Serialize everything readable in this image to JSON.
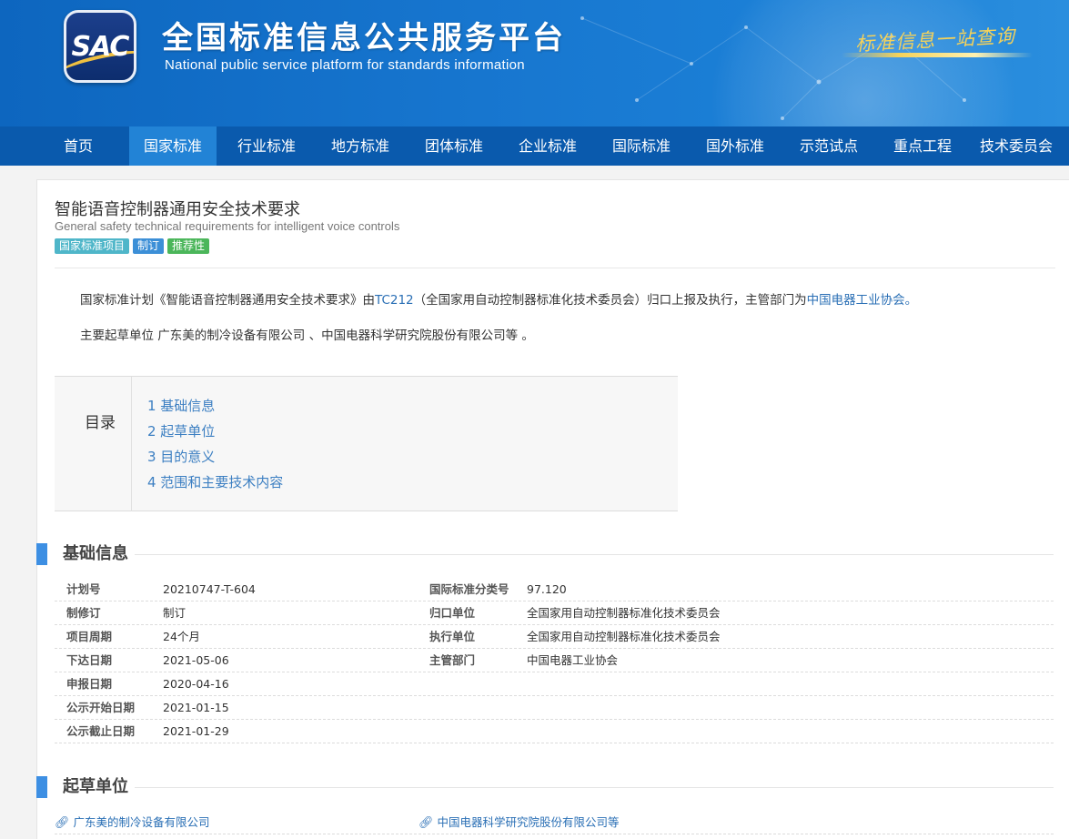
{
  "header": {
    "logo_text": "SAC",
    "title": "全国标准信息公共服务平台",
    "subtitle": "National public service platform  for standards information",
    "slogan": "标准信息一站查询"
  },
  "nav": [
    "首页",
    "国家标准",
    "行业标准",
    "地方标准",
    "团体标准",
    "企业标准",
    "国际标准",
    "国外标准",
    "示范试点",
    "重点工程",
    "技术委员会"
  ],
  "standard": {
    "title_cn": "智能语音控制器通用安全技术要求",
    "title_en": "General safety technical requirements for intelligent voice controls",
    "tags": [
      "国家标准项目",
      "制订",
      "推荐性"
    ]
  },
  "summary": {
    "p1_prefix": "国家标准计划《智能语音控制器通用安全技术要求》由",
    "p1_tc": "TC212",
    "p1_mid": "（全国家用自动控制器标准化技术委员会）归口上报及执行，主管部门为",
    "p1_dept": "中国电器工业协会",
    "p1_suffix": "。",
    "p2": "主要起草单位 广东美的制冷设备有限公司 、中国电器科学研究院股份有限公司等 。"
  },
  "toc": {
    "label": "目录",
    "items": [
      "1  基础信息",
      "2  起草单位",
      "3  目的意义",
      "4  范围和主要技术内容"
    ]
  },
  "basic_info": {
    "heading": "基础信息",
    "rows": [
      {
        "l1": "计划号",
        "v1": "20210747-T-604",
        "l2": "国际标准分类号",
        "v2": "97.120"
      },
      {
        "l1": "制修订",
        "v1": "制订",
        "l2": "归口单位",
        "v2": "全国家用自动控制器标准化技术委员会"
      },
      {
        "l1": "项目周期",
        "v1": "24个月",
        "l2": "执行单位",
        "v2": "全国家用自动控制器标准化技术委员会"
      },
      {
        "l1": "下达日期",
        "v1": "2021-05-06",
        "l2": "主管部门",
        "v2": "中国电器工业协会"
      },
      {
        "l1": "申报日期",
        "v1": "2020-04-16",
        "l2": "",
        "v2": ""
      },
      {
        "l1": "公示开始日期",
        "v1": "2021-01-15",
        "l2": "",
        "v2": ""
      },
      {
        "l1": "公示截止日期",
        "v1": "2021-01-29",
        "l2": "",
        "v2": ""
      }
    ]
  },
  "drafters": {
    "heading": "起草单位",
    "units": [
      "广东美的制冷设备有限公司",
      "中国电器科学研究院股份有限公司等"
    ]
  },
  "colors": {
    "nav_bg": "#0a5aad",
    "nav_active": "#2283d6",
    "link": "#2a6fb5",
    "section_bar": "#3d8fe3"
  },
  "icons": {
    "drafter_link": "link-icon"
  }
}
